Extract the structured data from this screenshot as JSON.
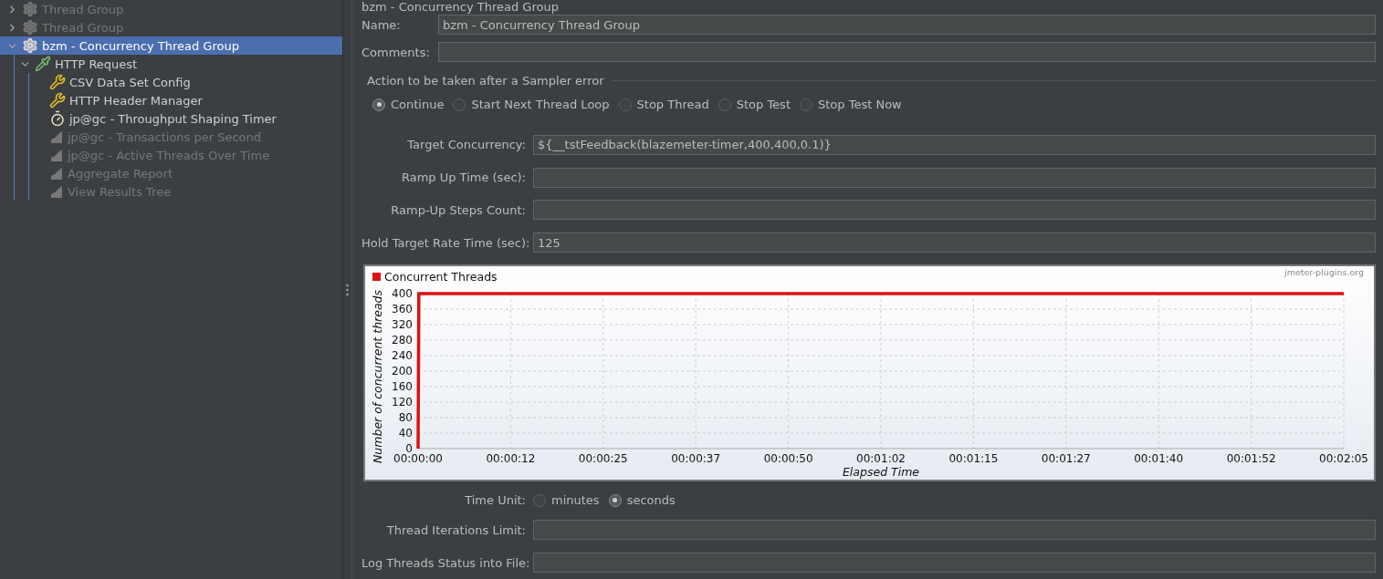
{
  "tree": [
    {
      "label": "Thread Group",
      "kind": "thread-group",
      "disabled": true,
      "selected": false,
      "expanded": false
    },
    {
      "label": "Thread Group",
      "kind": "thread-group",
      "disabled": true,
      "selected": false,
      "expanded": false
    },
    {
      "label": "bzm - Concurrency Thread Group",
      "kind": "thread-group",
      "disabled": false,
      "selected": true,
      "expanded": true,
      "children": [
        {
          "label": "HTTP Request",
          "kind": "sampler",
          "disabled": false,
          "selected": false,
          "expanded": true,
          "children": [
            {
              "label": "CSV Data Set Config",
              "kind": "config",
              "disabled": false,
              "selected": false
            },
            {
              "label": "HTTP Header Manager",
              "kind": "config",
              "disabled": false,
              "selected": false
            },
            {
              "label": "jp@gc - Throughput Shaping Timer",
              "kind": "timer",
              "disabled": false,
              "selected": false
            },
            {
              "label": "jp@gc - Transactions per Second",
              "kind": "listener",
              "disabled": true,
              "selected": false
            },
            {
              "label": "jp@gc - Active Threads Over Time",
              "kind": "listener",
              "disabled": true,
              "selected": false
            },
            {
              "label": "Aggregate Report",
              "kind": "listener",
              "disabled": true,
              "selected": false
            },
            {
              "label": "View Results Tree",
              "kind": "listener",
              "disabled": true,
              "selected": false
            }
          ]
        }
      ]
    }
  ],
  "panel": {
    "title": "bzm - Concurrency Thread Group",
    "name": {
      "label": "Name:",
      "value": "bzm - Concurrency Thread Group"
    },
    "comments": {
      "label": "Comments:"
    },
    "error_action": {
      "legend": "Action to be taken after a Sampler error",
      "options": [
        {
          "label": "Continue",
          "selected": true
        },
        {
          "label": "Start Next Thread Loop",
          "selected": false
        },
        {
          "label": "Stop Thread",
          "selected": false
        },
        {
          "label": "Stop Test",
          "selected": false
        },
        {
          "label": "Stop Test Now",
          "selected": false
        }
      ]
    },
    "fields": [
      {
        "label": "Target Concurrency:",
        "value": "${__tstFeedback(blazemeter-timer,400,400,0.1)}"
      },
      {
        "label": "Ramp Up Time (sec):"
      },
      {
        "label": "Ramp-Up Steps Count:"
      },
      {
        "label": "Hold Target Rate Time (sec):",
        "value": "125"
      }
    ],
    "chart": {
      "watermark": "jmeter-plugins.org",
      "chart_data": {
        "type": "line",
        "grid": true,
        "xlabel": "Elapsed Time",
        "ylabel": "Number of concurrent threads",
        "x": [
          0,
          0.1,
          125
        ],
        "series": [
          {
            "name": "Concurrent Threads",
            "color": "#dd1111",
            "line_style": "solid",
            "values": [
              0,
              400,
              400
            ]
          }
        ],
        "xlim": [
          0,
          125
        ],
        "ylim": [
          0,
          400
        ],
        "xticks": [
          {
            "value": 0,
            "label": "00:00:00"
          },
          {
            "value": 12.5,
            "label": "00:00:12"
          },
          {
            "value": 25,
            "label": "00:00:25"
          },
          {
            "value": 37.5,
            "label": "00:00:37"
          },
          {
            "value": 50,
            "label": "00:00:50"
          },
          {
            "value": 62.5,
            "label": "00:01:02"
          },
          {
            "value": 75,
            "label": "00:01:15"
          },
          {
            "value": 87.5,
            "label": "00:01:27"
          },
          {
            "value": 100,
            "label": "00:01:40"
          },
          {
            "value": 112.5,
            "label": "00:01:52"
          },
          {
            "value": 125,
            "label": "00:02:05"
          }
        ],
        "yticks": [
          0,
          40,
          80,
          120,
          160,
          200,
          240,
          280,
          320,
          360,
          400
        ]
      }
    },
    "time_unit": {
      "label": "Time Unit:",
      "options": [
        {
          "label": "minutes",
          "selected": false
        },
        {
          "label": "seconds",
          "selected": true
        }
      ]
    },
    "bottom_fields": [
      {
        "label": "Thread Iterations Limit:"
      },
      {
        "label": "Log Threads Status into File:"
      }
    ]
  }
}
